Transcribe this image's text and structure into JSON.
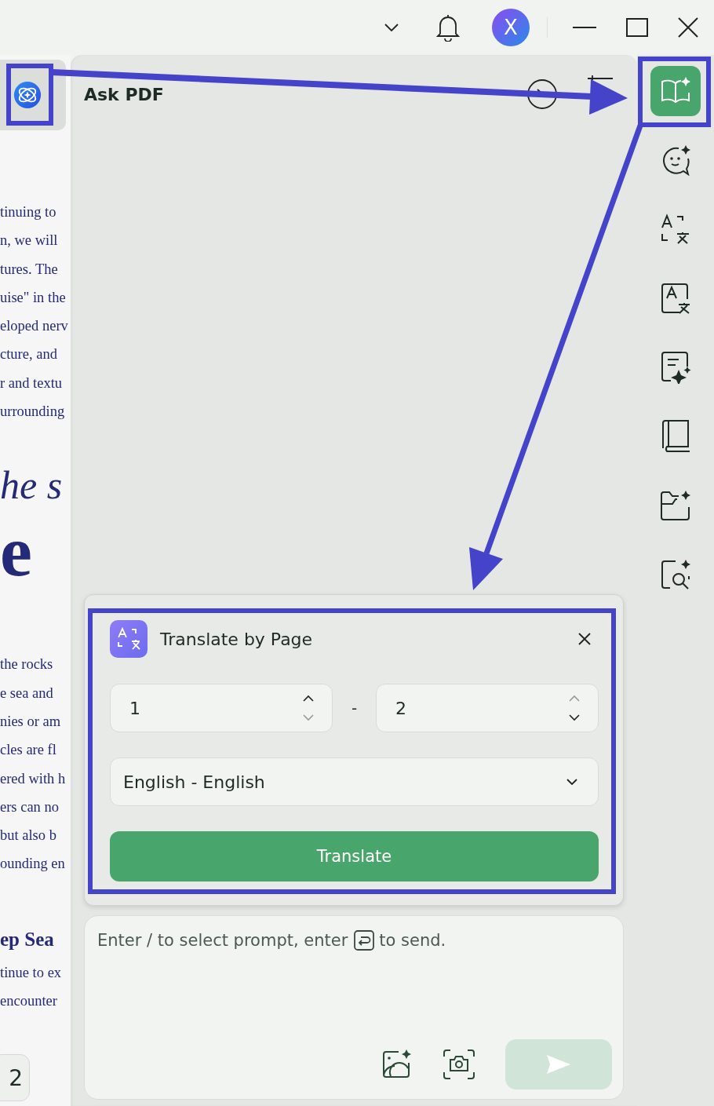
{
  "title_bar": {
    "avatar": "X"
  },
  "document": {
    "blocks": [
      {
        "kind": "para",
        "lines": [
          "tinuing to",
          "n, we will",
          "tures. The",
          "uise\" in the",
          "eloped nerv",
          "cture, and",
          "r and textu",
          "urrounding"
        ]
      },
      {
        "kind": "italic_title",
        "text": "he s"
      },
      {
        "kind": "title",
        "text": "e"
      },
      {
        "kind": "para",
        "lines": [
          "the rocks",
          "e sea and",
          "nies or am",
          "cles are fl",
          "ered with h",
          "ers can no",
          "but also b",
          "ounding en"
        ]
      },
      {
        "kind": "heading",
        "text": "ep Sea"
      },
      {
        "kind": "para",
        "lines": [
          "tinue to ex",
          "encounter"
        ]
      }
    ],
    "page_number": "2"
  },
  "panel": {
    "title": "Ask PDF"
  },
  "translate_card": {
    "title": "Translate by Page",
    "from_page": "1",
    "separator": "-",
    "to_page": "2",
    "language": "English - English",
    "button": "Translate"
  },
  "prompt": {
    "placeholder": "Enter / to select prompt, enter",
    "placeholder_end": "to send.",
    "send_disabled": true
  },
  "sidebar": {
    "tools": [
      {
        "kind": "ask",
        "selected": true
      },
      {
        "kind": "chat",
        "selected": false
      },
      {
        "kind": "translate",
        "selected": false
      },
      {
        "kind": "translate_page",
        "selected": false
      },
      {
        "kind": "summary",
        "selected": false
      },
      {
        "kind": "book",
        "selected": false
      },
      {
        "kind": "folder",
        "selected": false
      },
      {
        "kind": "search",
        "selected": false
      }
    ]
  }
}
